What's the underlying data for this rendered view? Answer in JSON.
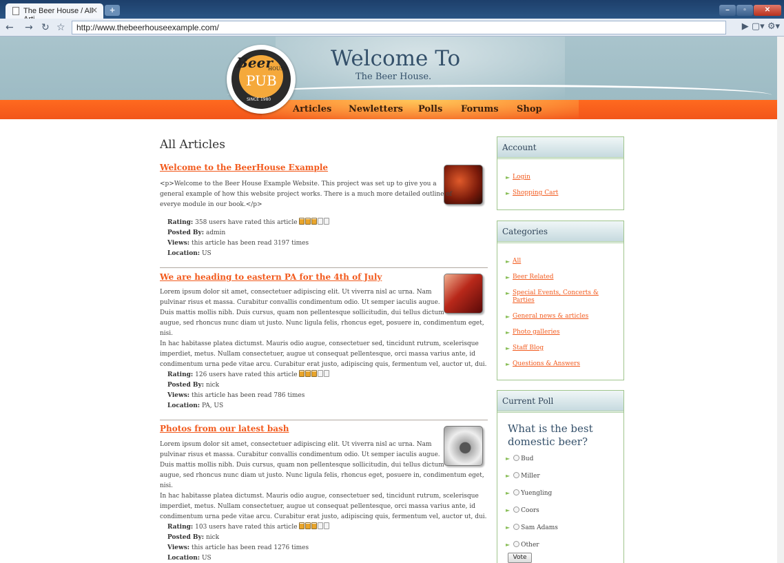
{
  "browser": {
    "tab_title": "The Beer House / All Arti...",
    "new_tab": "+",
    "url": "http://www.thebeerhouseexample.com/"
  },
  "header": {
    "logo": {
      "line1": "Beer",
      "line2": "HOUSE",
      "line3": "PUB",
      "since": "SINCE 1980"
    },
    "title": "Welcome To",
    "subtitle": "The Beer House.",
    "nav": [
      "Articles",
      "Newletters",
      "Polls",
      "Forums",
      "Shop"
    ]
  },
  "main": {
    "title": "All Articles",
    "articles": [
      {
        "title": "Welcome to the BeerHouse Example",
        "body_lines": [
          "<p>Welcome to the Beer House Example Website. This project was set up to give you a",
          "general example of how this website project works. There is a much more detailed outline of",
          "everye module in our book.</p>"
        ],
        "rating_label": "Rating:",
        "rating_text": "358 users have rated this article",
        "rating": 3,
        "rating_max": 5,
        "posted_by_label": "Posted By:",
        "posted_by": "admin",
        "views_label": "Views:",
        "views": "this article has been read 3197 times",
        "location_label": "Location:",
        "location": "US",
        "thumb_icon": "beer-glasses-icon"
      },
      {
        "title": "We are heading to eastern PA for the 4th of July",
        "body_lines": [
          "Lorem ipsum dolor sit amet, consectetuer adipiscing elit. Ut viverra nisl ac urna. Nam",
          "pulvinar risus et massa. Curabitur convallis condimentum odio. Ut semper iaculis augue.",
          "Duis mattis mollis nibh. Duis cursus, quam non pellentesque sollicitudin, dui tellus dictum",
          "augue, sed rhoncus nunc diam ut justo. Nunc ligula felis, rhoncus eget, posuere in, condimentum eget, nisi.",
          "In hac habitasse platea dictumst. Mauris odio augue, consectetuer sed, tincidunt rutrum, scelerisque",
          "imperdiet, metus. Nullam consectetuer, augue ut consequat pellentesque, orci massa varius ante, id",
          "condimentum urna pede vitae arcu. Curabitur erat justo, adipiscing quis, fermentum vel, auctor ut, dui."
        ],
        "rating_label": "Rating:",
        "rating_text": "126 users have rated this article",
        "rating": 3,
        "rating_max": 5,
        "posted_by_label": "Posted By:",
        "posted_by": "nick",
        "views_label": "Views:",
        "views": "this article has been read 786 times",
        "location_label": "Location:",
        "location": "PA, US",
        "thumb_icon": "pen-on-paper-icon"
      },
      {
        "title": "Photos from our latest bash",
        "body_lines": [
          "Lorem ipsum dolor sit amet, consectetuer adipiscing elit. Ut viverra nisl ac urna. Nam",
          "pulvinar risus et massa. Curabitur convallis condimentum odio. Ut semper iaculis augue.",
          "Duis mattis mollis nibh. Duis cursus, quam non pellentesque sollicitudin, dui tellus dictum",
          "augue, sed rhoncus nunc diam ut justo. Nunc ligula felis, rhoncus eget, posuere in, condimentum eget, nisi.",
          "In hac habitasse platea dictumst. Mauris odio augue, consectetuer sed, tincidunt rutrum, scelerisque",
          "imperdiet, metus. Nullam consectetuer, augue ut consequat pellentesque, orci massa varius ante, id",
          "condimentum urna pede vitae arcu. Curabitur erat justo, adipiscing quis, fermentum vel, auctor ut, dui."
        ],
        "rating_label": "Rating:",
        "rating_text": "103 users have rated this article",
        "rating": 3,
        "rating_max": 5,
        "posted_by_label": "Posted By:",
        "posted_by": "nick",
        "views_label": "Views:",
        "views": "this article has been read 1276 times",
        "location_label": "Location:",
        "location": "US",
        "thumb_icon": "camera-icon"
      }
    ]
  },
  "sidebar": {
    "account": {
      "title": "Account",
      "links": [
        "Login",
        "Shopping Cart"
      ]
    },
    "categories": {
      "title": "Categories",
      "links": [
        "All",
        "Beer Related",
        "Special Events, Concerts & Parties",
        "General news & articles",
        "Photo galleries",
        "Staff Blog",
        "Questions & Answers"
      ]
    },
    "poll": {
      "title": "Current Poll",
      "question": "What is the best domestic beer?",
      "options": [
        "Bud",
        "Miller",
        "Yuengling",
        "Coors",
        "Sam Adams",
        "Other"
      ],
      "vote_label": "Vote"
    }
  },
  "colors": {
    "link": "#f25a1d",
    "nav_bar": "#ff6a1f",
    "header_sky": "#a9c4cc",
    "heading": "#34506a",
    "box_border": "#9fc58c"
  }
}
